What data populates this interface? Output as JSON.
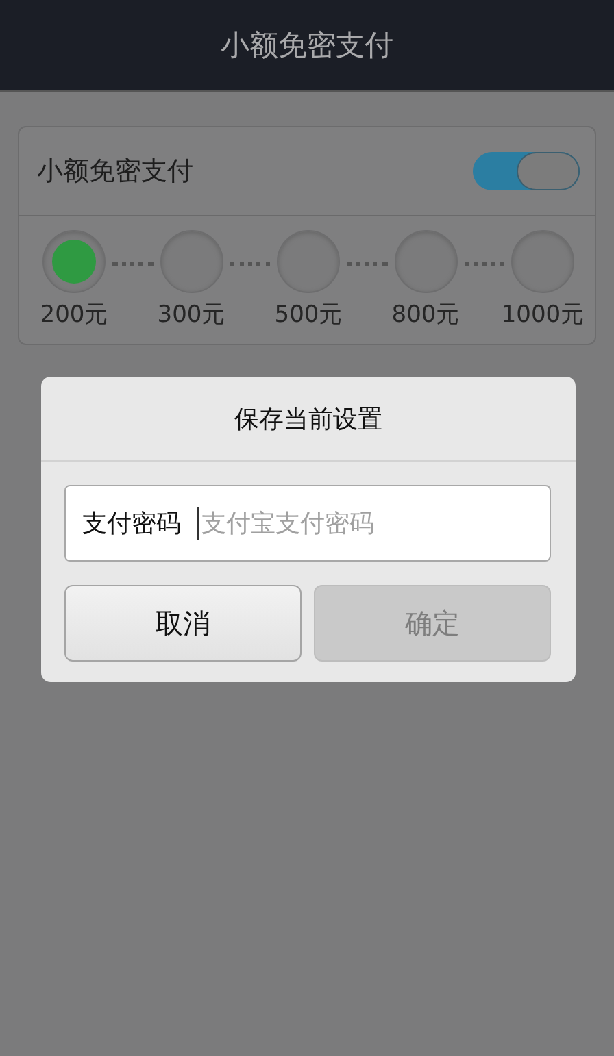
{
  "app_bar": {
    "title": "小额免密支付"
  },
  "settings_card": {
    "toggle": {
      "label": "小额免密支付",
      "on": true
    },
    "amounts": [
      {
        "label": "200元",
        "selected": true
      },
      {
        "label": "300元",
        "selected": false
      },
      {
        "label": "500元",
        "selected": false
      },
      {
        "label": "800元",
        "selected": false
      },
      {
        "label": "1000元",
        "selected": false
      }
    ]
  },
  "dialog": {
    "title": "保存当前设置",
    "password_field": {
      "label": "支付密码",
      "placeholder": "支付宝支付密码"
    },
    "buttons": [
      {
        "label": "取消",
        "disabled": false
      },
      {
        "label": "确定",
        "disabled": true
      }
    ]
  }
}
